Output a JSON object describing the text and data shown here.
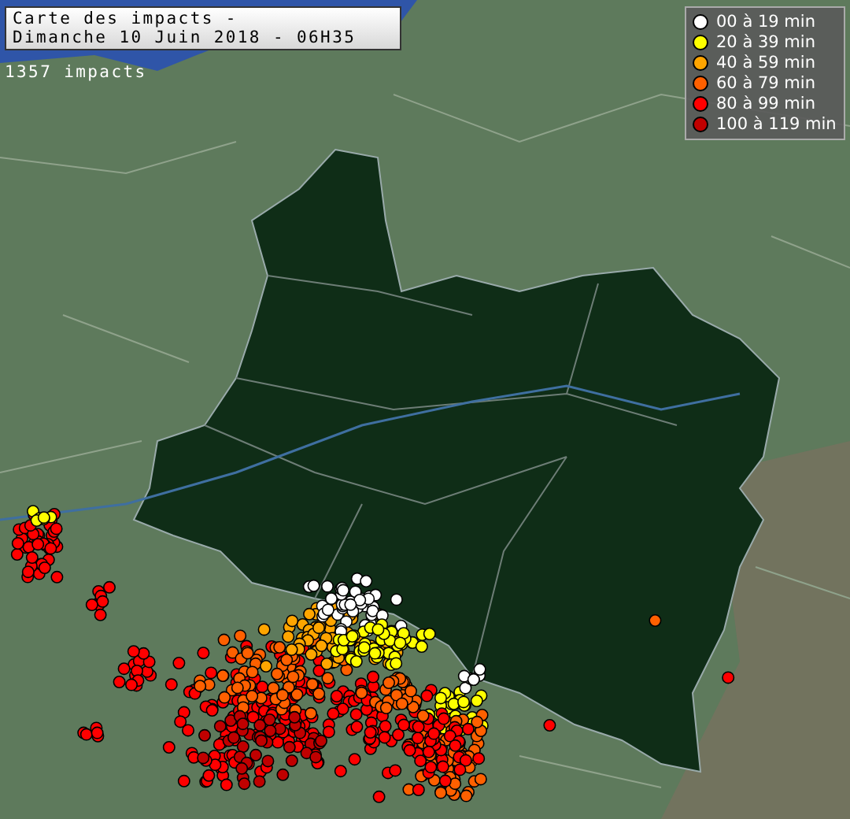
{
  "title": {
    "lines": [
      "Carte des impacts -",
      "Dimanche 10 Juin 2018 - 06H35"
    ]
  },
  "impact_count": "1357 impacts",
  "legend": [
    {
      "label": "00 à 19 min",
      "color": "#ffffff"
    },
    {
      "label": "20 à 39 min",
      "color": "#ffff00"
    },
    {
      "label": "40 à 59 min",
      "color": "#ffa500"
    },
    {
      "label": "60 à 79 min",
      "color": "#ff6000"
    },
    {
      "label": "80 à 99 min",
      "color": "#ff0000"
    },
    {
      "label": "100 à 119 min",
      "color": "#c00000"
    }
  ]
}
